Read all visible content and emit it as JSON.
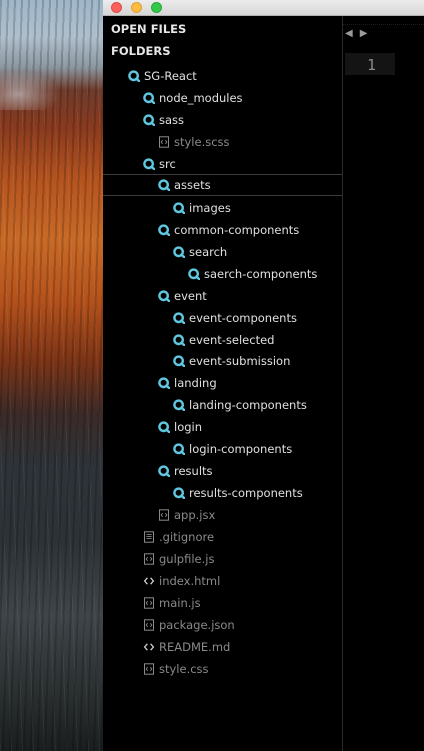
{
  "sidebar": {
    "open_files_label": "OPEN FILES",
    "folders_label": "FOLDERS",
    "tree": [
      {
        "label": "SG-React",
        "kind": "folder"
      },
      {
        "label": "node_modules",
        "kind": "folder"
      },
      {
        "label": "sass",
        "kind": "folder"
      },
      {
        "label": "style.scss",
        "kind": "file",
        "icon": "code-file-icon"
      },
      {
        "label": "src",
        "kind": "folder"
      },
      {
        "label": "assets",
        "kind": "folder",
        "selected": true
      },
      {
        "label": "images",
        "kind": "folder"
      },
      {
        "label": "common-components",
        "kind": "folder"
      },
      {
        "label": "search",
        "kind": "folder"
      },
      {
        "label": "saerch-components",
        "kind": "folder"
      },
      {
        "label": "event",
        "kind": "folder"
      },
      {
        "label": "event-components",
        "kind": "folder"
      },
      {
        "label": "event-selected",
        "kind": "folder"
      },
      {
        "label": "event-submission",
        "kind": "folder"
      },
      {
        "label": "landing",
        "kind": "folder"
      },
      {
        "label": "landing-components",
        "kind": "folder"
      },
      {
        "label": "login",
        "kind": "folder"
      },
      {
        "label": "login-components",
        "kind": "folder"
      },
      {
        "label": "results",
        "kind": "folder"
      },
      {
        "label": "results-components",
        "kind": "folder"
      },
      {
        "label": "app.jsx",
        "kind": "file",
        "icon": "code-file-icon"
      },
      {
        "label": ".gitignore",
        "kind": "file",
        "icon": "text-file-icon"
      },
      {
        "label": "gulpfile.js",
        "kind": "file",
        "icon": "code-file-icon"
      },
      {
        "label": "index.html",
        "kind": "file",
        "icon": "angle-brackets-icon"
      },
      {
        "label": "main.js",
        "kind": "file",
        "icon": "code-file-icon"
      },
      {
        "label": "package.json",
        "kind": "file",
        "icon": "code-file-icon"
      },
      {
        "label": "README.md",
        "kind": "file",
        "icon": "angle-brackets-icon"
      },
      {
        "label": "style.css",
        "kind": "file",
        "icon": "code-file-icon"
      }
    ]
  },
  "editor": {
    "nav_back": "◀",
    "nav_forward": "▶",
    "line_number": "1"
  },
  "colors": {
    "folder_icon": "#5fc8e0",
    "file_text": "#8a8a8a",
    "folder_text": "#e0e0e0"
  }
}
